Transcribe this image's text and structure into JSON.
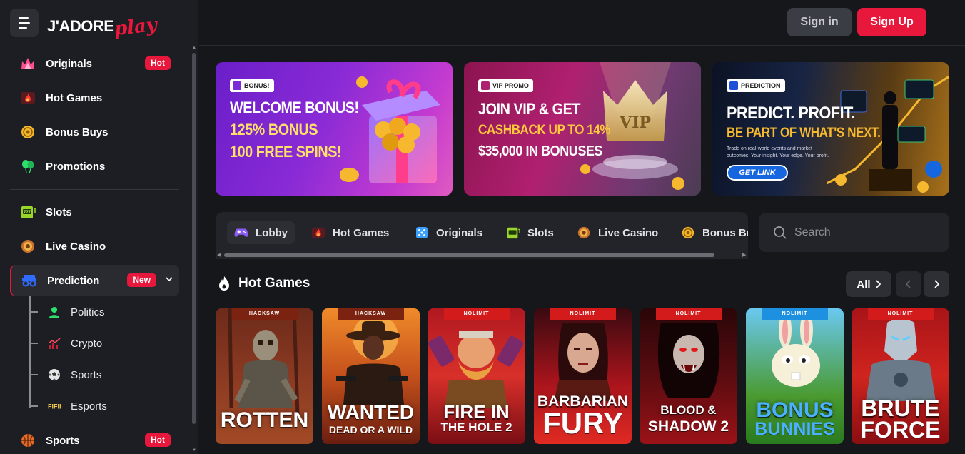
{
  "brand": {
    "logo_main": "J'ADORE",
    "logo_play": "play"
  },
  "header": {
    "signin_label": "Sign in",
    "signup_label": "Sign Up"
  },
  "sidebar": {
    "items": [
      {
        "label": "Originals",
        "badge": "Hot",
        "icon": "crown-fire-icon"
      },
      {
        "label": "Hot Games",
        "icon": "fire-icon"
      },
      {
        "label": "Bonus Buys",
        "icon": "coin-icon"
      },
      {
        "label": "Promotions",
        "icon": "balloons-icon"
      },
      {
        "label": "Slots",
        "icon": "slot-machine-icon"
      },
      {
        "label": "Live Casino",
        "icon": "roulette-icon"
      },
      {
        "label": "Prediction",
        "badge": "New",
        "icon": "glasses-icon"
      },
      {
        "label": "Sports",
        "badge": "Hot",
        "icon": "basketball-icon"
      }
    ],
    "prediction_sub": [
      {
        "label": "Politics",
        "icon": "person-icon"
      },
      {
        "label": "Crypto",
        "icon": "chart-icon"
      },
      {
        "label": "Sports",
        "icon": "soccer-ball-icon"
      },
      {
        "label": "Esports",
        "icon": "fifa-icon"
      }
    ]
  },
  "banners": [
    {
      "tag": "BONUS!",
      "lines": [
        "WELCOME BONUS!",
        "125% BONUS",
        "100 FREE SPINS!"
      ]
    },
    {
      "tag": "VIP PROMO",
      "lines": [
        "JOIN VIP & GET",
        "CASHBACK UP TO 14%",
        "$35,000 IN BONUSES"
      ]
    },
    {
      "tag": "PREDICTION",
      "lines": [
        "PREDICT. PROFIT.",
        "BE PART OF WHAT'S NEXT."
      ],
      "small": "Trade on real-world events and market outcomes. Your insight. Your edge. Your profit.",
      "cta": "GET LINK"
    }
  ],
  "tabs": [
    {
      "label": "Lobby",
      "icon": "gamepad-icon"
    },
    {
      "label": "Hot Games",
      "icon": "fire-icon"
    },
    {
      "label": "Originals",
      "icon": "dice-icon"
    },
    {
      "label": "Slots",
      "icon": "slot-machine-icon"
    },
    {
      "label": "Live Casino",
      "icon": "roulette-icon"
    },
    {
      "label": "Bonus Bu",
      "icon": "coin-icon"
    }
  ],
  "search": {
    "placeholder": "Search"
  },
  "section": {
    "title": "Hot Games",
    "all_label": "All"
  },
  "games": [
    {
      "provider": "HACKSAW",
      "title": "ROTTEN",
      "subtitle": ""
    },
    {
      "provider": "HACKSAW",
      "title": "WANTED",
      "subtitle": "DEAD OR A WILD"
    },
    {
      "provider": "NOLIMIT",
      "title": "FIRE IN",
      "subtitle": "THE HOLE 2"
    },
    {
      "provider": "NOLIMIT",
      "title": "BARBARIAN",
      "subtitle": "FURY"
    },
    {
      "provider": "NOLIMIT",
      "title": "BLOOD &",
      "subtitle": "SHADOW 2"
    },
    {
      "provider": "NOLIMIT",
      "title": "BONUS",
      "subtitle": "BUNNIES"
    },
    {
      "provider": "NOLIMIT",
      "title": "BRUTE",
      "subtitle": "FORCE"
    }
  ],
  "colors": {
    "accent": "#e8173c",
    "bg": "#16171b",
    "sidebar": "#1d1e23",
    "panel": "#222429"
  }
}
